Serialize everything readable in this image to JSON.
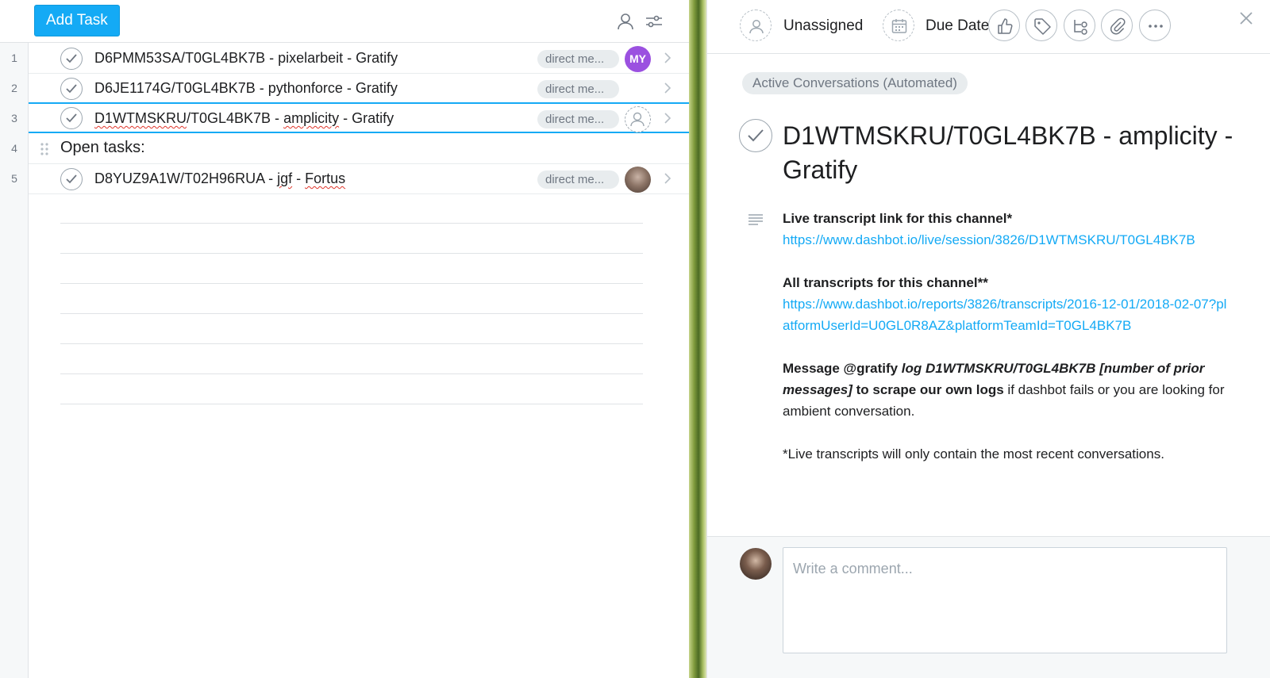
{
  "toolbar": {
    "add_task_label": "Add Task",
    "icons": [
      "person-icon",
      "filter-sliders-icon"
    ]
  },
  "tasks": [
    {
      "num": "1",
      "name_plain": "D6PMM53SA/T0GL4BK7B - pixelarbeit - Gratify",
      "tag": "direct me...",
      "avatar": "MY",
      "avatar_color": "#9b51e0"
    },
    {
      "num": "2",
      "name_plain": "D6JE1174G/T0GL4BK7B - pythonforce - Gratify",
      "tag": "direct me...",
      "avatar": ""
    },
    {
      "num": "3",
      "name_a": "D1WTMSKRU",
      "name_b": "/T0GL4BK7B - ",
      "name_c": "amplicity",
      "name_d": " - Gratify",
      "tag": "direct me...",
      "avatar": ""
    },
    {
      "num": "5",
      "name_a": "D8YUZ9A1W/T02H96RUA - ",
      "name_b": "jgf",
      "name_c": " - ",
      "name_d": "Fortus",
      "tag": "direct me...",
      "avatar": ""
    }
  ],
  "section": {
    "num": "4",
    "title": "Open tasks:"
  },
  "detail": {
    "assignee": "Unassigned",
    "due_date": "Due Date",
    "project": "Active Conversations (Automated)",
    "title": "D1WTMSKRU/T0GL4BK7B - amplicity - Gratify",
    "desc": {
      "live_heading": "Live transcript link for this channel*",
      "live_link": "https://www.dashbot.io/live/session/3826/D1WTMSKRU/T0GL4BK7B",
      "all_heading": "All transcripts for this channel**",
      "all_link": "https://www.dashbot.io/reports/3826/transcripts/2016-12-01/2018-02-07?platformUserId=U0GL0R8AZ&platformTeamId=T0GL4BK7B",
      "msg_bold1": "Message @gratify ",
      "msg_bolditalic": "log D1WTMSKRU/T0GL4BK7B [number of prior messages]",
      "msg_bold2": " to scrape our own logs",
      "msg_rest": " if dashbot fails or you are looking for ambient conversation.",
      "footnote": "*Live transcripts will only contain the most recent conversations."
    },
    "comment_placeholder": "Write a comment..."
  },
  "colors": {
    "accent": "#14aaf5",
    "avatar_purple": "#9b51e0"
  }
}
